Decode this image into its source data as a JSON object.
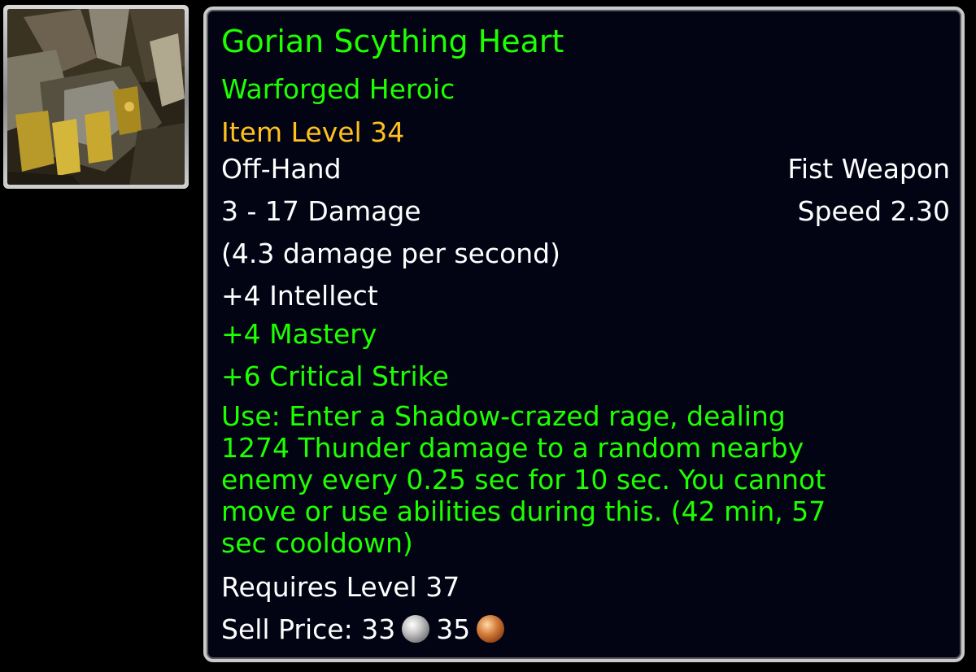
{
  "icon": {
    "name": "fist-weapon-icon"
  },
  "item": {
    "name": "Gorian Scything Heart",
    "quality_tag": "Warforged Heroic",
    "item_level": "Item Level 34",
    "slot": "Off-Hand",
    "weapon_type": "Fist Weapon",
    "damage": "3 - 17 Damage",
    "speed": "Speed 2.30",
    "dps": "(4.3 damage per second)",
    "stats": {
      "intellect": "+4 Intellect",
      "mastery": "+4 Mastery",
      "critical_strike": "+6 Critical Strike"
    },
    "use_effect": "Use: Enter a Shadow-crazed rage, dealing\n1274 Thunder damage to a random nearby\nenemy every 0.25 sec for 10 sec. You cannot\nmove or use abilities during this. (42 min, 57\nsec cooldown)",
    "requires": "Requires Level 37",
    "sell_price": {
      "label": "Sell Price:",
      "silver": "33",
      "copper": "35"
    }
  },
  "colors": {
    "uncommon_green": "#1eff00",
    "item_level_gold": "#ffc020",
    "text_white": "#ffffff",
    "tooltip_bg": "#020414",
    "border": "#c9c9c9"
  }
}
